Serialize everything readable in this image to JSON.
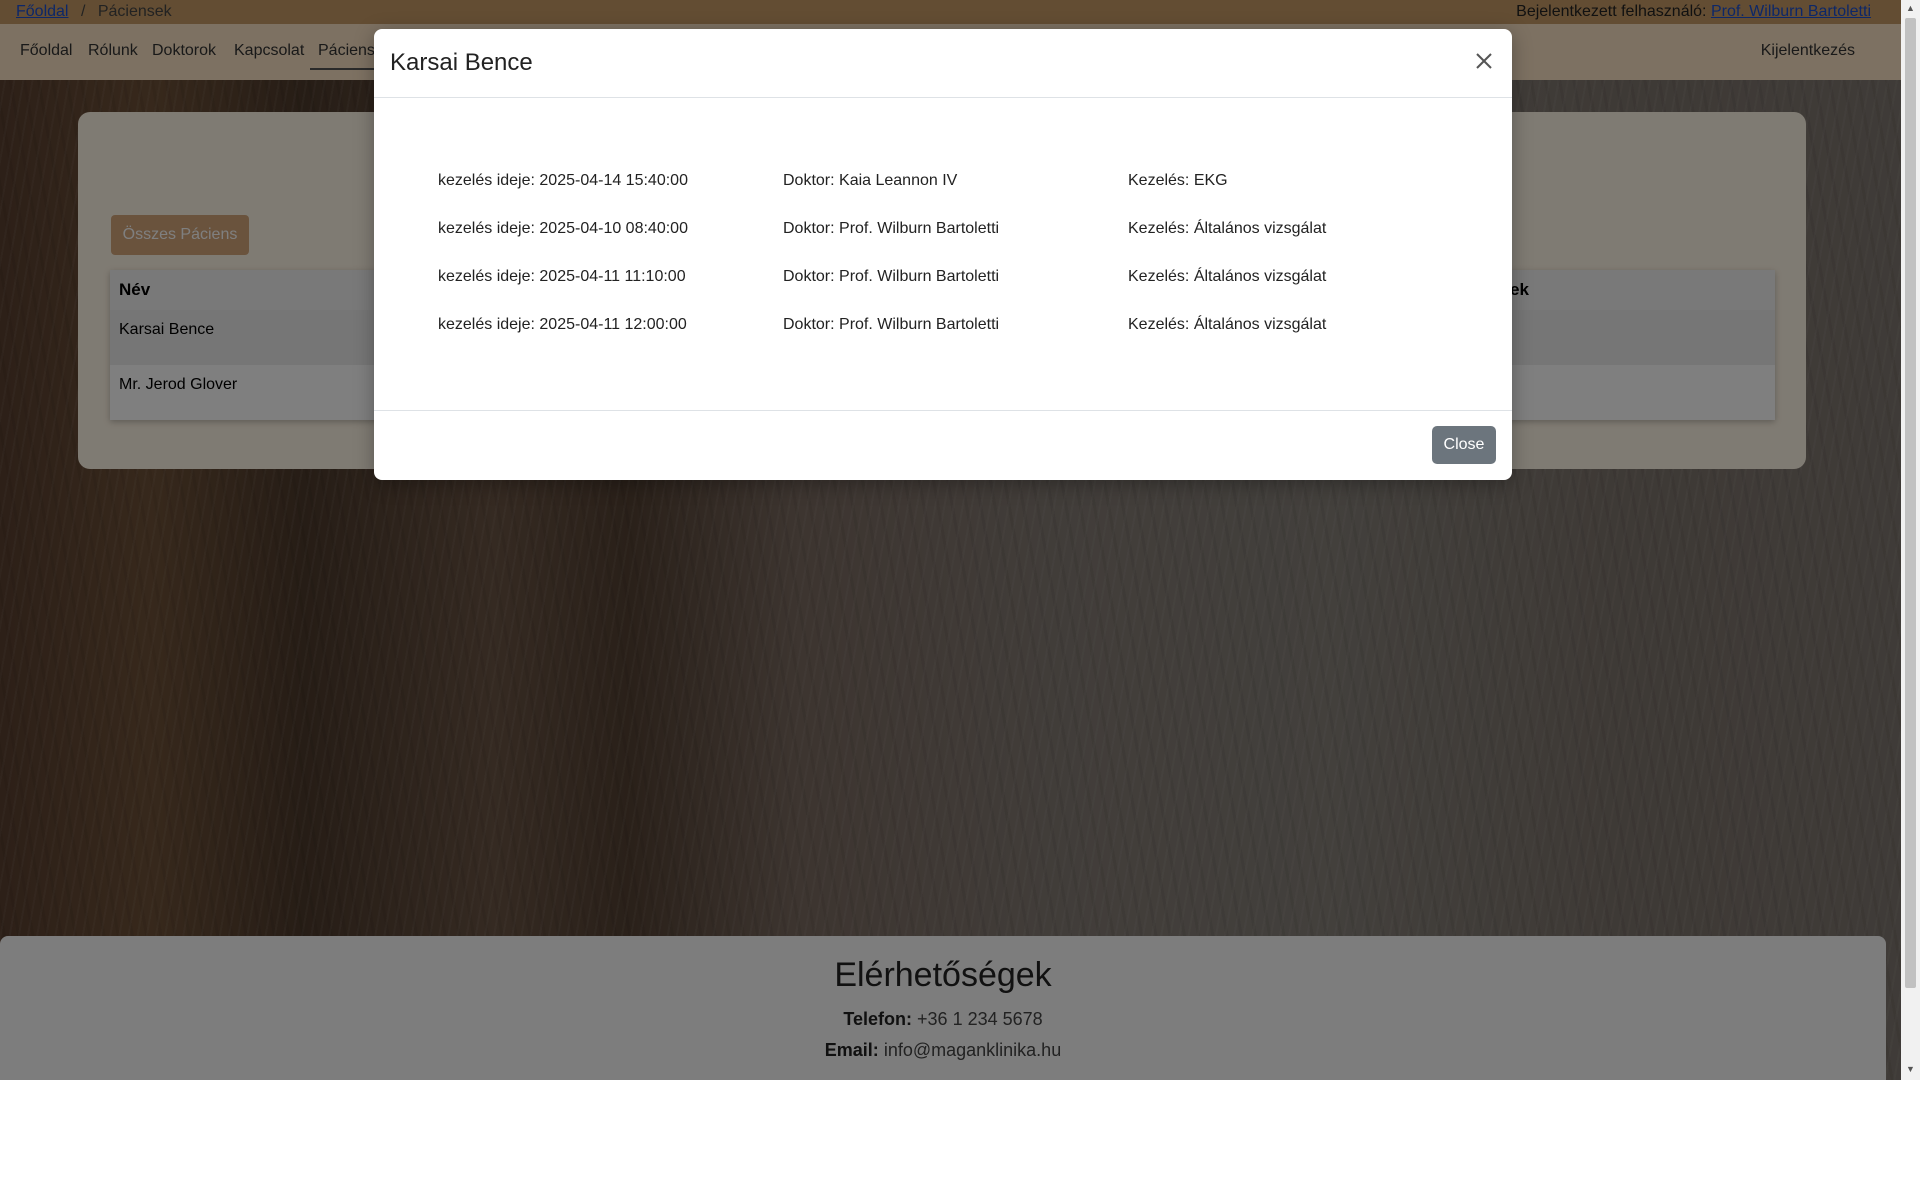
{
  "breadcrumb": {
    "home": "Főoldal",
    "separator": "/",
    "current": "Páciensek"
  },
  "login": {
    "prefix": "Bejelentkezett felhasználó:",
    "user": "Prof. Wilburn Bartoletti"
  },
  "nav": {
    "items": [
      "Főoldal",
      "Rólunk",
      "Doktorok",
      "Kapcsolat",
      "Páciensek"
    ],
    "logout": "Kijelentkezés"
  },
  "page": {
    "all_patients_button": "Összes Páciens",
    "table": {
      "headers": [
        "Név",
        "ek"
      ],
      "rows": [
        "Karsai Bence",
        "Mr. Jerod Glover"
      ]
    }
  },
  "footer": {
    "title": "Elérhetőségek",
    "phone_label": "Telefon:",
    "phone": "+36 1 234 5678",
    "email_label": "Email:",
    "email": "info@maganklinika.hu"
  },
  "modal": {
    "title": "Karsai Bence",
    "entries": [
      {
        "time": "kezelés ideje: 2025-04-14 15:40:00",
        "doctor": "Doktor: Kaia Leannon IV",
        "treatment": "Kezelés: EKG"
      },
      {
        "time": "kezelés ideje: 2025-04-10 08:40:00",
        "doctor": "Doktor: Prof. Wilburn Bartoletti",
        "treatment": "Kezelés: Általános vizsgálat"
      },
      {
        "time": "kezelés ideje: 2025-04-11 11:10:00",
        "doctor": "Doktor: Prof. Wilburn Bartoletti",
        "treatment": "Kezelés: Általános vizsgálat"
      },
      {
        "time": "kezelés ideje: 2025-04-11 12:00:00",
        "doctor": "Doktor: Prof. Wilburn Bartoletti",
        "treatment": "Kezelés: Általános vizsgálat"
      }
    ],
    "close_label": "Close"
  },
  "colors": {
    "breadcrumb_bg": "#c79b66",
    "navbar_bg": "#fae3c4",
    "accent_button": "#d4a77b",
    "close_button": "#6c757d",
    "link": "#1a4fd0"
  },
  "icons": {
    "modal_close": "close-icon"
  }
}
